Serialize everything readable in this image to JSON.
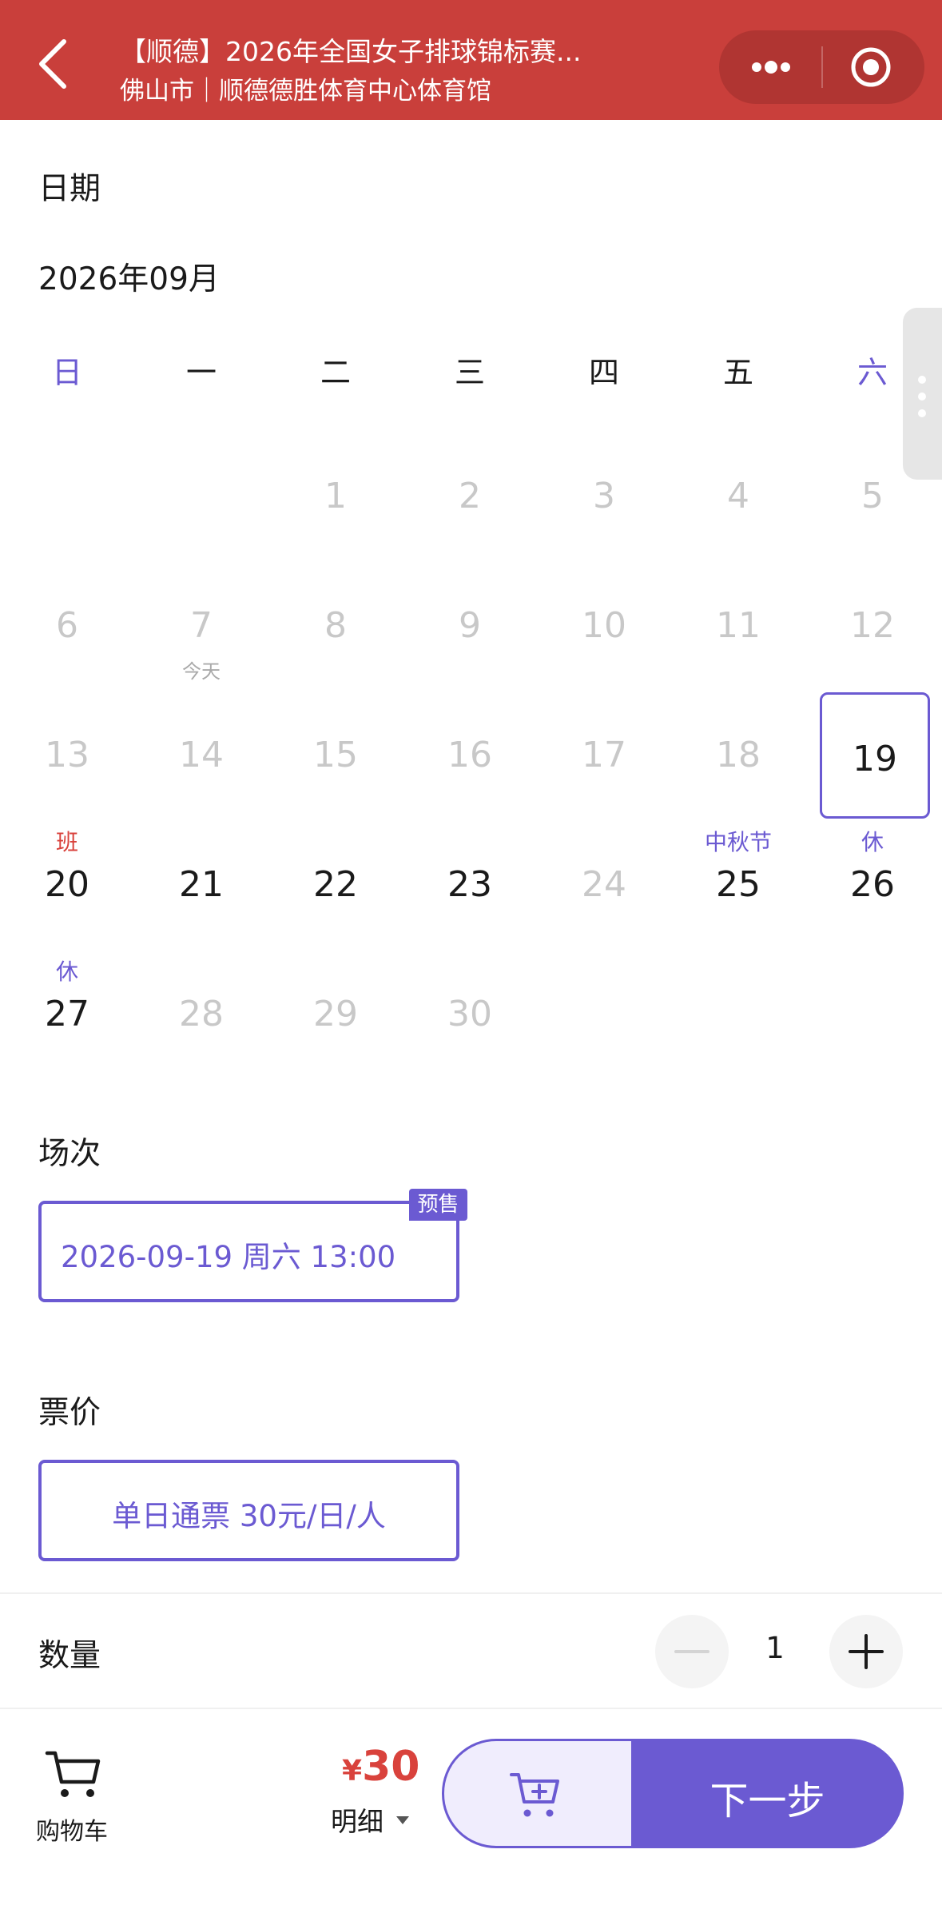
{
  "header": {
    "title": "【顺德】2026年全国女子排球锦标赛...",
    "subtitle": "佛山市｜顺德德胜体育中心体育馆"
  },
  "date_section": {
    "title": "日期",
    "month": "2026年09月"
  },
  "weekdays": [
    "日",
    "一",
    "二",
    "三",
    "四",
    "五",
    "六"
  ],
  "calendar": {
    "row1": [
      "1",
      "2",
      "3",
      "4",
      "5"
    ],
    "row2": [
      "6",
      "7",
      "8",
      "9",
      "10",
      "11",
      "12"
    ],
    "today_label": "今天",
    "row3": [
      "13",
      "14",
      "15",
      "16",
      "17",
      "18",
      "19"
    ],
    "row4": [
      "20",
      "21",
      "22",
      "23",
      "24",
      "25",
      "26"
    ],
    "row4_tags": {
      "d20": "班",
      "d25": "中秋节",
      "d26": "休"
    },
    "row5": [
      "27",
      "28",
      "29",
      "30"
    ],
    "row5_tags": {
      "d27": "休"
    }
  },
  "session_section": {
    "title": "场次",
    "session": "2026-09-19 周六 13:00",
    "badge": "预售"
  },
  "price_section": {
    "title": "票价",
    "option": "单日通票 30元/日/人"
  },
  "quantity": {
    "label": "数量",
    "value": "1"
  },
  "bottom": {
    "cart_label": "购物车",
    "currency": "¥",
    "total": "30",
    "detail": "明细",
    "next": "下一步"
  },
  "colors": {
    "header": "#c93f3b",
    "accent": "#6b5ad2",
    "price": "#d9423c"
  },
  "icons": [
    "back-icon",
    "more-icon",
    "target-icon",
    "minus-icon",
    "plus-icon",
    "cart-icon",
    "add-to-cart-icon",
    "caret-down-icon"
  ]
}
